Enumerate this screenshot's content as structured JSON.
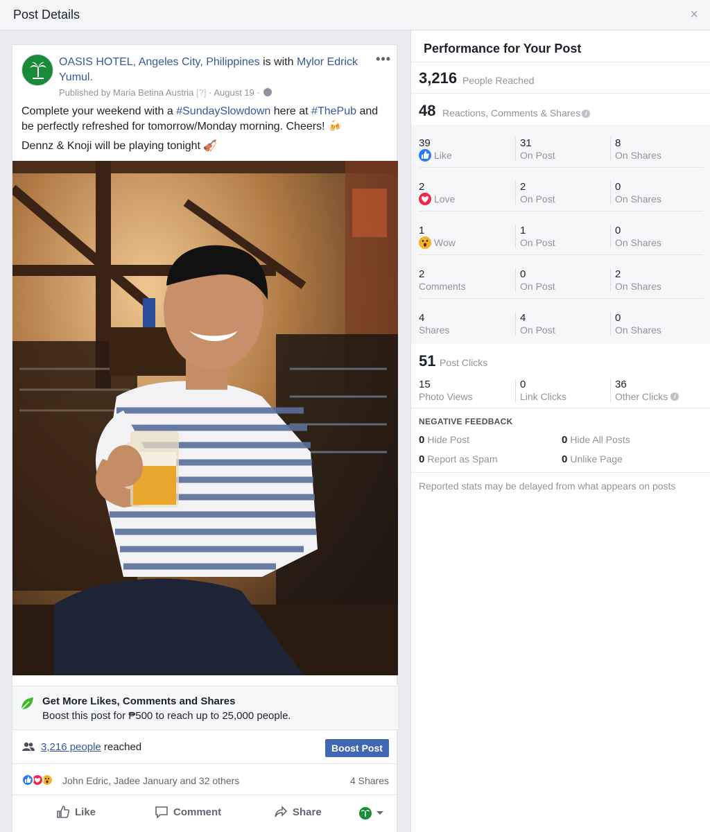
{
  "header": {
    "title": "Post Details",
    "close": "×"
  },
  "post": {
    "page_name": "OASIS HOTEL, Angeles City, Philippines",
    "with_text": "is with",
    "tagged_person": "Mylor Edrick Yumul.",
    "more": "•••",
    "published_by": "Published by Maria Betina Austria",
    "help": "[?]",
    "date": "· August 19 ·",
    "text_1": "Complete your weekend with a",
    "hashtag_1": "#SundaySlowdown",
    "text_2": "here at",
    "hashtag_2": "#ThePub",
    "text_3": "and be perfectly refreshed for tomorrow/Monday morning. Cheers! 🍻",
    "text_4": "Dennz & Knoji will be playing tonight 🎻"
  },
  "boost": {
    "title": "Get More Likes, Comments and Shares",
    "subtitle": "Boost this post for ₱500 to reach up to 25,000 people.",
    "people_link": "3,216 people",
    "reached": "reached",
    "button": "Boost Post"
  },
  "reactions": {
    "names": "John Edric, Jadee January and 32 others",
    "shares": "4 Shares"
  },
  "actions": {
    "like": "Like",
    "comment": "Comment",
    "share": "Share"
  },
  "performance": {
    "title": "Performance for Your Post",
    "reached_num": "3,216",
    "reached_label": "People Reached",
    "engage_num": "48",
    "engage_label": "Reactions, Comments & Shares",
    "rows": [
      {
        "total": "39",
        "label": "Like",
        "on_post": "31",
        "on_post_label": "On Post",
        "on_shares": "8",
        "on_shares_label": "On Shares"
      },
      {
        "total": "2",
        "label": "Love",
        "on_post": "2",
        "on_post_label": "On Post",
        "on_shares": "0",
        "on_shares_label": "On Shares"
      },
      {
        "total": "1",
        "label": "Wow",
        "on_post": "1",
        "on_post_label": "On Post",
        "on_shares": "0",
        "on_shares_label": "On Shares"
      },
      {
        "total": "2",
        "label": "Comments",
        "on_post": "0",
        "on_post_label": "On Post",
        "on_shares": "2",
        "on_shares_label": "On Shares"
      },
      {
        "total": "4",
        "label": "Shares",
        "on_post": "4",
        "on_post_label": "On Post",
        "on_shares": "0",
        "on_shares_label": "On Shares"
      }
    ],
    "clicks_num": "51",
    "clicks_label": "Post Clicks",
    "photo_views": "15",
    "photo_views_label": "Photo Views",
    "link_clicks": "0",
    "link_clicks_label": "Link Clicks",
    "other_clicks": "36",
    "other_clicks_label": "Other Clicks",
    "negative_title": "NEGATIVE FEEDBACK",
    "hide_post": "0",
    "hide_post_label": "Hide Post",
    "hide_all": "0",
    "hide_all_label": "Hide All Posts",
    "spam": "0",
    "spam_label": "Report as Spam",
    "unlike": "0",
    "unlike_label": "Unlike Page",
    "footnote": "Reported stats may be delayed from what appears on posts"
  },
  "colors": {
    "link": "#365899",
    "button": "#4267b2",
    "like": "#2e7bf6",
    "love": "#f0284a",
    "wow": "#f7b125",
    "brand_green": "#1a8a3a"
  }
}
